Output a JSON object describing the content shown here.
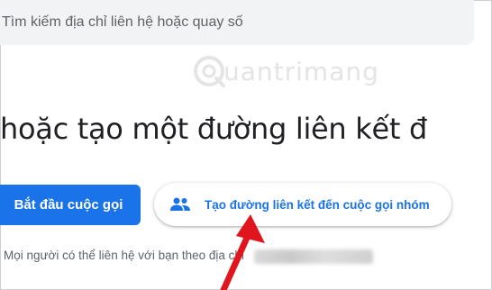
{
  "search": {
    "placeholder": "Tìm kiếm địa chỉ liên hệ hoặc quay số"
  },
  "watermark": {
    "text": "uantrimang",
    "logo_icon": "quantrimang-logo-icon"
  },
  "main": {
    "headline": "hoặc tạo một đường liên kết đ",
    "start_button": "Bắt đầu cuộc gọi",
    "group_link_button": "Tạo đường liên kết đến cuộc gọi nhóm",
    "footnote": "Mọi người có thể liên hệ với bạn theo địa chỉ"
  },
  "colors": {
    "accent": "#1a73e8",
    "arrow": "#e0151d",
    "search_bg": "#f1f3f4"
  },
  "icons": {
    "group": "group-people-icon",
    "annotation": "red-arrow-icon"
  }
}
